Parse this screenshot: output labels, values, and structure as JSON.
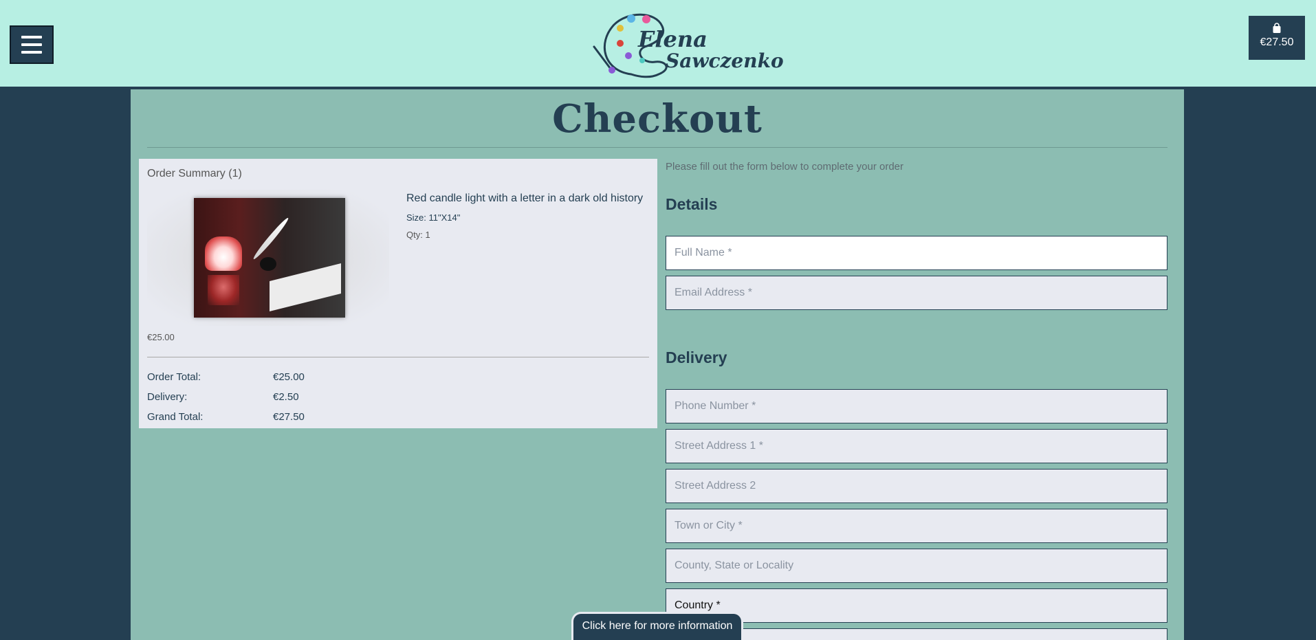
{
  "brand": {
    "name_line1": "Elena",
    "name_line2": "Sawczenko",
    "palette_dot_colors": [
      "#e85a9b",
      "#5bb5e6",
      "#e0c03a",
      "#d9443a",
      "#8a5ad6",
      "#4ec9c0"
    ]
  },
  "header": {
    "menu_icon": "hamburger-icon",
    "cart_icon": "shopping-bag-icon",
    "cart_total": "€27.50"
  },
  "page": {
    "title": "Checkout"
  },
  "order_summary": {
    "title": "Order Summary (1)",
    "item": {
      "name": "Red candle light with a letter in a dark old history",
      "size": "Size: 11\"X14\"",
      "qty": "Qty: 1",
      "price": "€25.00"
    },
    "totals": [
      {
        "label": "Order Total:",
        "value": "€25.00"
      },
      {
        "label": "Delivery:",
        "value": "€2.50"
      },
      {
        "label": "Grand Total:",
        "value": "€27.50"
      }
    ]
  },
  "form": {
    "intro": "Please fill out the form below to complete your order",
    "details_heading": "Details",
    "delivery_heading": "Delivery",
    "fields": {
      "full_name": "Full Name *",
      "email": "Email Address *",
      "phone": "Phone Number *",
      "street1": "Street Address 1 *",
      "street2": "Street Address 2",
      "town": "Town or City *",
      "county": "County, State or Locality",
      "country": "Country *"
    }
  },
  "info_tab": {
    "label": "Click here for more information"
  },
  "colors": {
    "header_bg": "#b7efe3",
    "page_bg": "#243f52",
    "content_bg": "#8cbdb2",
    "panel_bg": "#e8eaf1"
  }
}
